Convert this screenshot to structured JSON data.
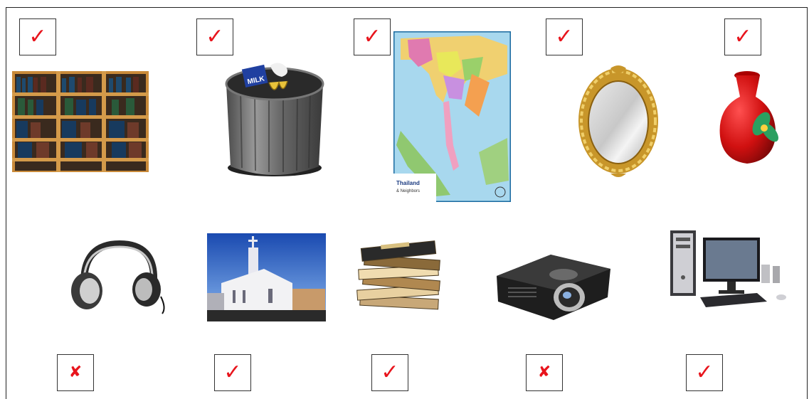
{
  "marks_row1": [
    "✓",
    "✓",
    "✓",
    "✓",
    "✓"
  ],
  "marks_row2": [
    "✘",
    "✓",
    "✓",
    "✘",
    "✓"
  ],
  "images_row1": [
    "bookshelf",
    "trash-can",
    "map",
    "mirror",
    "vase"
  ],
  "images_row2": [
    "headphones",
    "church",
    "books",
    "projector",
    "computer"
  ],
  "colors": {
    "check": "#e8141c",
    "border": "#333333"
  }
}
